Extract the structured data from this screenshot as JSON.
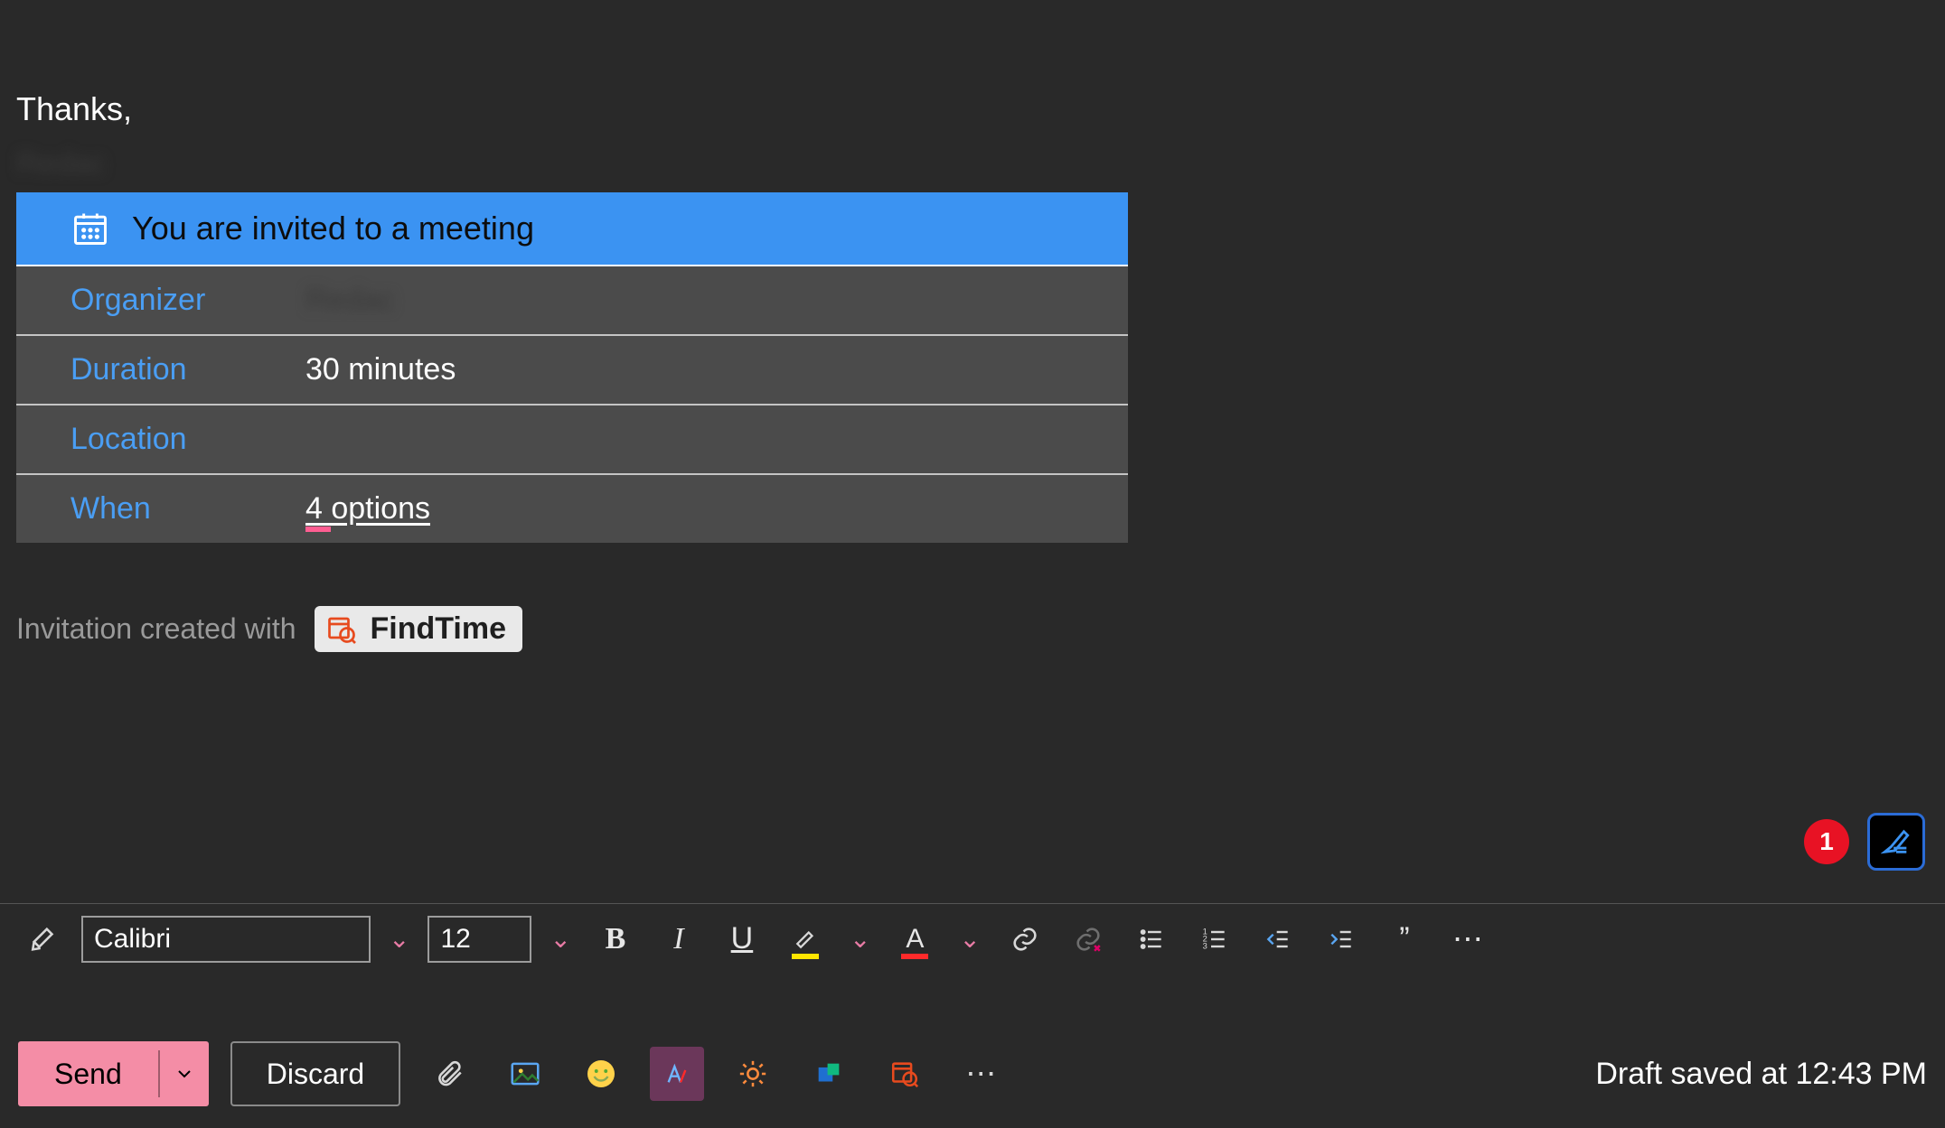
{
  "body": {
    "signoff": "Thanks,",
    "redacted_sender": "Redac"
  },
  "meeting_card": {
    "title": "You are invited to a meeting",
    "rows": {
      "organizer_label": "Organizer",
      "organizer_value": "Redac",
      "duration_label": "Duration",
      "duration_value": "30 minutes",
      "location_label": "Location",
      "location_value": "",
      "when_label": "When",
      "when_value": "4 options"
    }
  },
  "invite_footer": {
    "text": "Invitation created with",
    "chip": "FindTime"
  },
  "float": {
    "badge_count": "1"
  },
  "format_bar": {
    "font": "Calibri",
    "size": "12"
  },
  "actions": {
    "send": "Send",
    "discard": "Discard",
    "status": "Draft saved at 12:43 PM"
  },
  "icons": {
    "format_painter": "format-painter",
    "bold": "B",
    "italic": "I",
    "underline": "U",
    "highlight": "highlight",
    "font_color": "A",
    "link": "link",
    "unlink": "unlink",
    "bullets": "bullets",
    "numbering": "numbering",
    "outdent": "outdent",
    "indent": "indent",
    "quote": "”",
    "more": "⋯"
  }
}
